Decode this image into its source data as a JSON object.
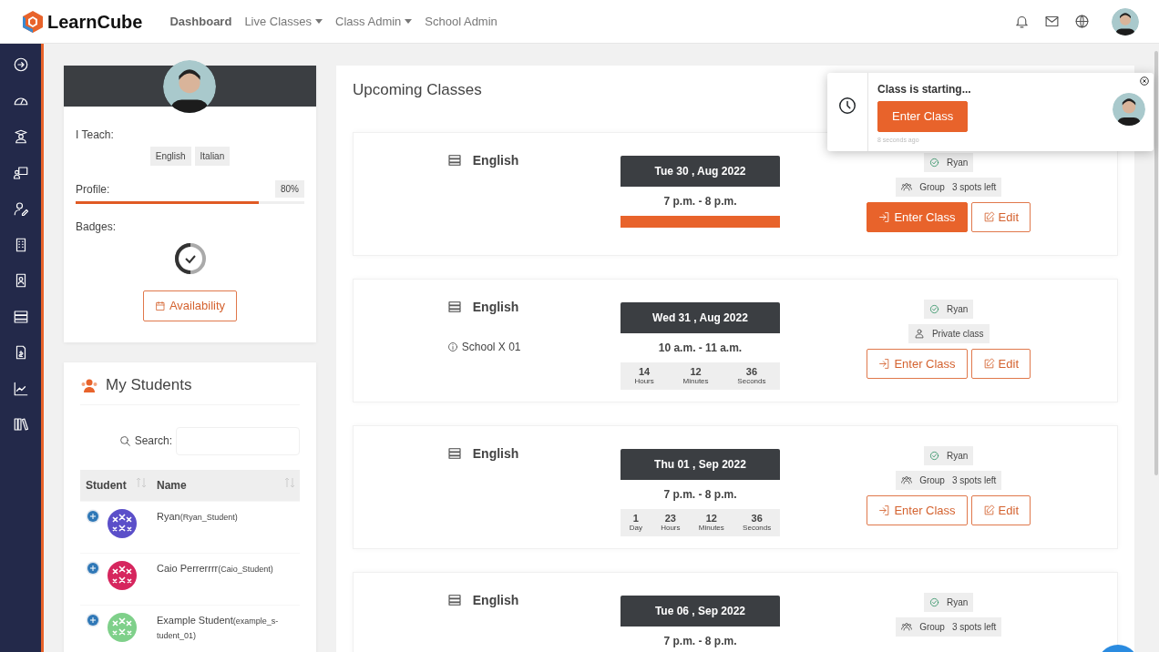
{
  "brand": "LearnCube",
  "nav": [
    {
      "label": "Dashboard",
      "selected": true,
      "dropdown": false
    },
    {
      "label": "Live Classes",
      "selected": false,
      "dropdown": true
    },
    {
      "label": "Class Admin",
      "selected": false,
      "dropdown": true
    },
    {
      "label": "School Admin",
      "selected": false,
      "dropdown": false
    }
  ],
  "sidebar": {
    "items": [
      {
        "kind": "arrow"
      },
      {
        "kind": "gauge"
      },
      {
        "kind": "graduate"
      },
      {
        "kind": "teacher"
      },
      {
        "kind": "user-edit"
      },
      {
        "kind": "building"
      },
      {
        "kind": "badge"
      },
      {
        "kind": "server"
      },
      {
        "kind": "invoice"
      },
      {
        "kind": "chart"
      },
      {
        "kind": "library"
      }
    ]
  },
  "profile": {
    "teach_label": "I Teach:",
    "languages": [
      "English",
      "Italian"
    ],
    "profile_label": "Profile:",
    "profile_reading": "80%",
    "level": 0.8,
    "badges_label": "Badges:",
    "availability_button": "Availability"
  },
  "students": {
    "title": "My Students",
    "search_label": "Search:",
    "columns": [
      "Student",
      "Name"
    ],
    "rows": [
      {
        "name": "Ryan",
        "username": "(Ryan_Student)",
        "color": "#5b4fc9"
      },
      {
        "name": "Caio Perrerrrr",
        "username": "(Caio_Student)",
        "color": "#d6265e"
      },
      {
        "name": "Example Student",
        "username": "(example_s-tudent_01)",
        "color": "#7fd08a"
      }
    ]
  },
  "upcoming": {
    "title": "Upcoming Classes",
    "classes": [
      {
        "language": "English",
        "date": "Tue 30 , Aug 2022",
        "time": "7 p.m. - 8 p.m.",
        "live": true,
        "teacher": "Ryan",
        "kind": "group",
        "type_label": "Group",
        "spots": "3 spots left",
        "enter": "Enter Class",
        "enter_active": true,
        "edit": "Edit"
      },
      {
        "language": "English",
        "location": "School X 01",
        "date": "Wed 31 , Aug 2022",
        "time": "10 a.m. - 11 a.m.",
        "live": false,
        "countdown": [
          {
            "value": "14",
            "unit": "Hours"
          },
          {
            "value": "12",
            "unit": "Minutes"
          },
          {
            "value": "36",
            "unit": "Seconds"
          }
        ],
        "teacher": "Ryan",
        "kind": "private",
        "type_label": "Private class",
        "enter": "Enter Class",
        "enter_active": false,
        "edit": "Edit"
      },
      {
        "language": "English",
        "date": "Thu 01 , Sep 2022",
        "time": "7 p.m. - 8 p.m.",
        "live": false,
        "countdown": [
          {
            "value": "1",
            "unit": "Day"
          },
          {
            "value": "23",
            "unit": "Hours"
          },
          {
            "value": "12",
            "unit": "Minutes"
          },
          {
            "value": "36",
            "unit": "Seconds"
          }
        ],
        "teacher": "Ryan",
        "kind": "group",
        "type_label": "Group",
        "spots": "3 spots left",
        "enter": "Enter Class",
        "enter_active": false,
        "edit": "Edit"
      },
      {
        "language": "English",
        "date": "Tue 06 , Sep 2022",
        "time": "7 p.m. - 8 p.m.",
        "teacher": "Ryan",
        "kind": "group",
        "type_label": "Group",
        "spots": "3 spots left"
      }
    ]
  },
  "notification": {
    "title": "Class is starting...",
    "button": "Enter Class",
    "time": "8 seconds ago"
  }
}
